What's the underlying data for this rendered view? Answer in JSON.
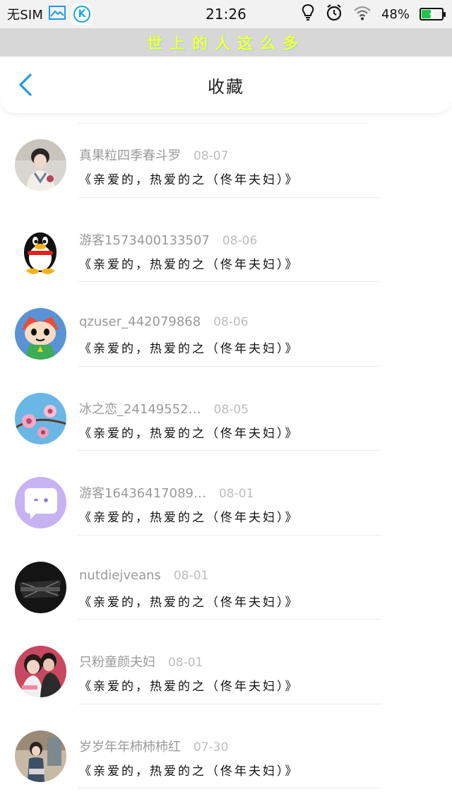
{
  "status_bar": {
    "sim": "无SIM",
    "time": "21:26",
    "battery_percent": "48%",
    "battery_level": 0.48,
    "icons": [
      "gallery-icon",
      "k-app-icon",
      "bulb-icon",
      "alarm-icon",
      "wifi-icon",
      "battery-icon"
    ]
  },
  "banner": {
    "text": "世上的人这么多"
  },
  "header": {
    "title": "收藏",
    "back_icon": "chevron-left-icon"
  },
  "colors": {
    "accent": "#1e9be8",
    "username": "#9a9a9a",
    "date": "#bdbdbd"
  },
  "items": [
    {
      "user": "真果粒四季春斗罗",
      "date": "08-07",
      "content": "《亲爱的，热爱的之（佟年夫妇）》",
      "avatar": "woman-portrait"
    },
    {
      "user": "游客1573400133507",
      "date": "08-06",
      "content": "《亲爱的，热爱的之（佟年夫妇）》",
      "avatar": "qq-penguin"
    },
    {
      "user": "qzuser_442079868",
      "date": "08-06",
      "content": "《亲爱的，热爱的之（佟年夫妇）》",
      "avatar": "cartoon-boy"
    },
    {
      "user": "冰之恋_24149552…",
      "date": "08-05",
      "content": "《亲爱的，热爱的之（佟年夫妇）》",
      "avatar": "pink-flowers"
    },
    {
      "user": "游客16436417089…",
      "date": "08-01",
      "content": "《亲爱的，热爱的之（佟年夫妇）》",
      "avatar": "purple-chat"
    },
    {
      "user": "nutdiejveans",
      "date": "08-01",
      "content": "《亲爱的，热爱的之（佟年夫妇）》",
      "avatar": "dark-object"
    },
    {
      "user": "只粉童颜夫妇",
      "date": "08-01",
      "content": "《亲爱的，热爱的之（佟年夫妇）》",
      "avatar": "couple-photo"
    },
    {
      "user": "岁岁年年柿柿柿红",
      "date": "07-30",
      "content": "《亲爱的，热爱的之（佟年夫妇）》",
      "avatar": "girl-street"
    }
  ]
}
